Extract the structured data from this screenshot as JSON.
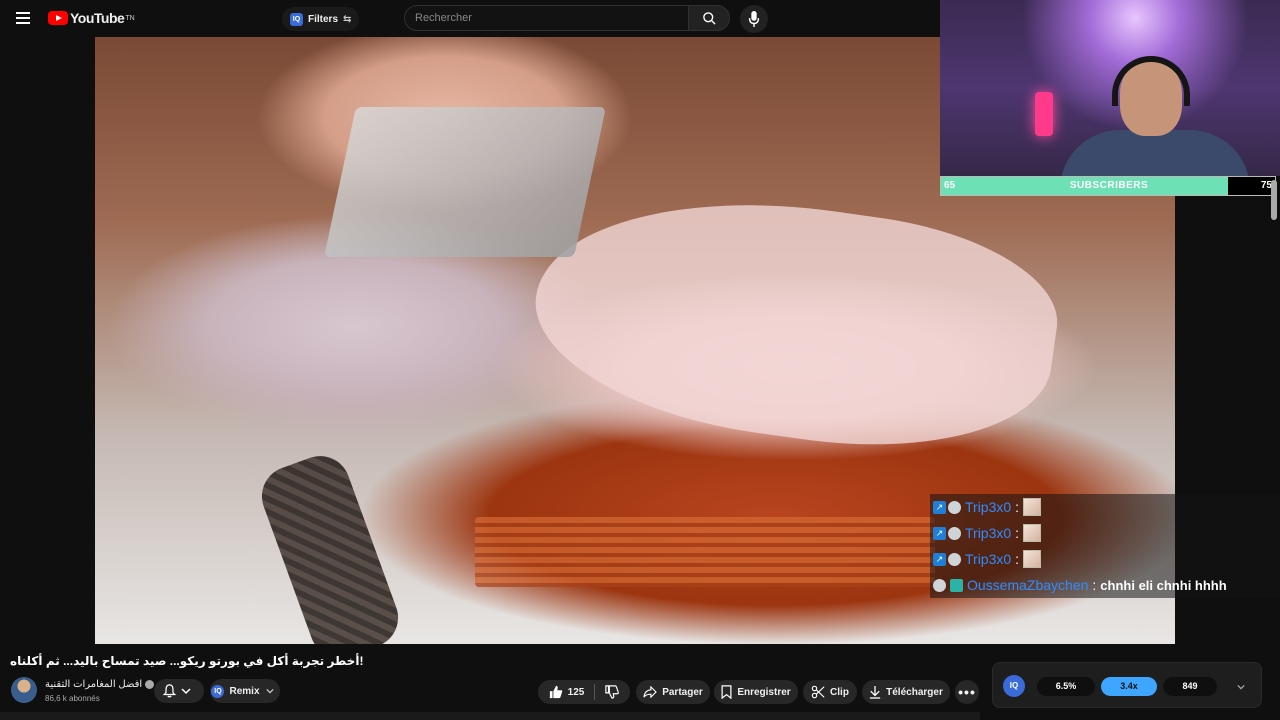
{
  "header": {
    "logo_text": "YouTube",
    "logo_sup": "TN",
    "filters_label": "Filters",
    "iq_label": "IQ",
    "search_placeholder": "Rechercher"
  },
  "overlay": {
    "sub_goal": {
      "current": "65",
      "label": "SUBSCRIBERS",
      "goal": "75",
      "fill": 0.86
    },
    "chat": [
      {
        "user": "Trip3x0",
        "type": "emote"
      },
      {
        "user": "Trip3x0",
        "type": "emote"
      },
      {
        "user": "Trip3x0",
        "type": "emote"
      },
      {
        "user": "OussemaZbaychen",
        "type": "text",
        "message": "chnhi eli chnhi hhhh"
      }
    ]
  },
  "video": {
    "title": "أخطر تجربة أكل في بورتو ريكو... صيد تمساح باليد... ثم أكلناه!",
    "channel_name": "افضل المغامرات التقنية",
    "subscribers": "86,6 k abonnés"
  },
  "actions": {
    "remix": "Remix",
    "likes": "125",
    "share": "Partager",
    "save": "Enregistrer",
    "clip": "Clip",
    "download": "Télécharger"
  },
  "stats": {
    "iq": "IQ",
    "values": [
      "6.5%",
      "3.4x",
      "849"
    ],
    "colors": {
      "accent": "#3ea6ff",
      "dark": "#0f0f0f"
    }
  }
}
